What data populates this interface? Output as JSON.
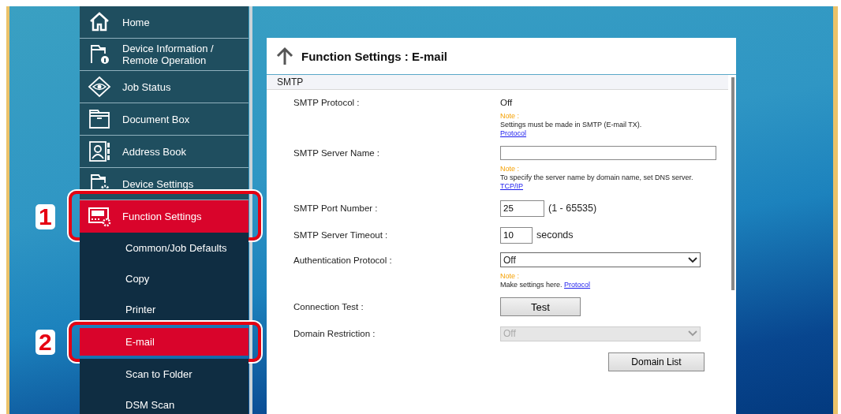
{
  "sidebar": {
    "items": [
      {
        "label": "Home",
        "selected": false
      },
      {
        "label": "Device Information /\nRemote Operation",
        "selected": false
      },
      {
        "label": "Job Status",
        "selected": false
      },
      {
        "label": "Document Box",
        "selected": false
      },
      {
        "label": "Address Book",
        "selected": false
      },
      {
        "label": "Device Settings",
        "selected": false
      },
      {
        "label": "Function Settings",
        "selected": true,
        "callout": "1",
        "children": [
          {
            "label": "Common/Job Defaults",
            "selected": false
          },
          {
            "label": "Copy",
            "selected": false
          },
          {
            "label": "Printer",
            "selected": false
          },
          {
            "label": "E-mail",
            "selected": true,
            "callout": "2"
          },
          {
            "label": "Scan to Folder",
            "selected": false
          },
          {
            "label": "DSM Scan",
            "selected": false
          }
        ]
      }
    ]
  },
  "panel": {
    "title": "Function Settings : E-mail",
    "section": "SMTP",
    "rows": [
      {
        "kind": "text",
        "label": "SMTP Protocol :",
        "value": "Off",
        "note": {
          "heading": "Note :",
          "text": "Settings must be made in SMTP (E-mail TX).",
          "link": "Protocol",
          "inline": false
        }
      },
      {
        "kind": "input",
        "label": "SMTP Server Name :",
        "note": {
          "heading": "Note :",
          "text": "To specify the server name by domain name, set DNS server.",
          "link": "TCP/IP",
          "inline": false
        }
      },
      {
        "kind": "number",
        "label": "SMTP Port Number :",
        "value": "25",
        "suffix": "(1 - 65535)"
      },
      {
        "kind": "number",
        "label": "SMTP Server Timeout :",
        "value": "10",
        "suffix": "seconds"
      },
      {
        "kind": "select",
        "label": "Authentication Protocol :",
        "value": "Off",
        "disabled": false,
        "note": {
          "heading": "Note :",
          "text": "Make settings here.",
          "link": "Protocol",
          "inline": true
        }
      },
      {
        "kind": "button",
        "label": "Connection Test :",
        "value": "Test"
      },
      {
        "kind": "select",
        "label": "Domain Restriction :",
        "value": "Off",
        "disabled": true
      }
    ],
    "footer_button": "Domain List"
  }
}
